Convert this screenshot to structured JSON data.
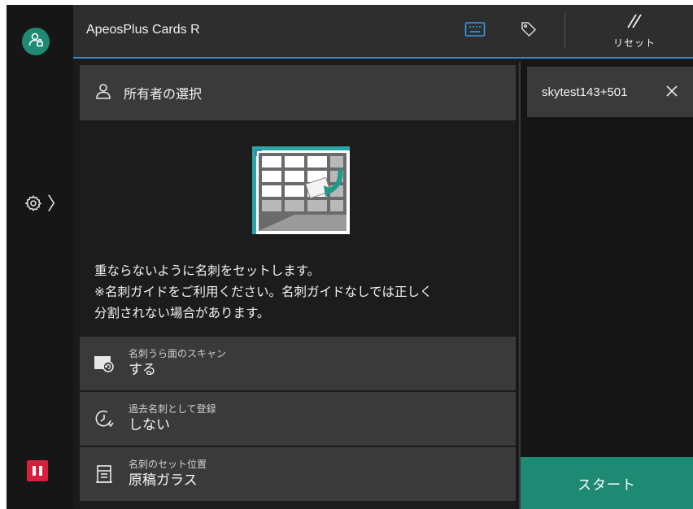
{
  "header": {
    "app_title": "ApeosPlus Cards R",
    "reset_label": "リセット",
    "accent_color": "#2b8fd6"
  },
  "rail": {
    "user_icon": "user-account-icon",
    "settings_icon": "gear-icon",
    "pause_icon": "pause-icon",
    "pause_color": "#d6203e"
  },
  "main": {
    "owner_select_label": "所有者の選択",
    "guide_lines": [
      "重ならないように名刺をセットします。",
      "※名刺ガイドをご利用ください。名刺ガイドなしでは正しく",
      "分割されない場合があります。"
    ],
    "settings": [
      {
        "label": "名刺うら面のスキャン",
        "value": "する",
        "icon": "back-side-scan-icon"
      },
      {
        "label": "過去名刺として登録",
        "value": "しない",
        "icon": "history-icon"
      },
      {
        "label": "名刺のセット位置",
        "value": "原稿ガラス",
        "icon": "document-glass-icon"
      }
    ]
  },
  "right": {
    "selected_user": "skytest143+501",
    "start_label": "スタート",
    "start_color": "#1f8a73"
  }
}
